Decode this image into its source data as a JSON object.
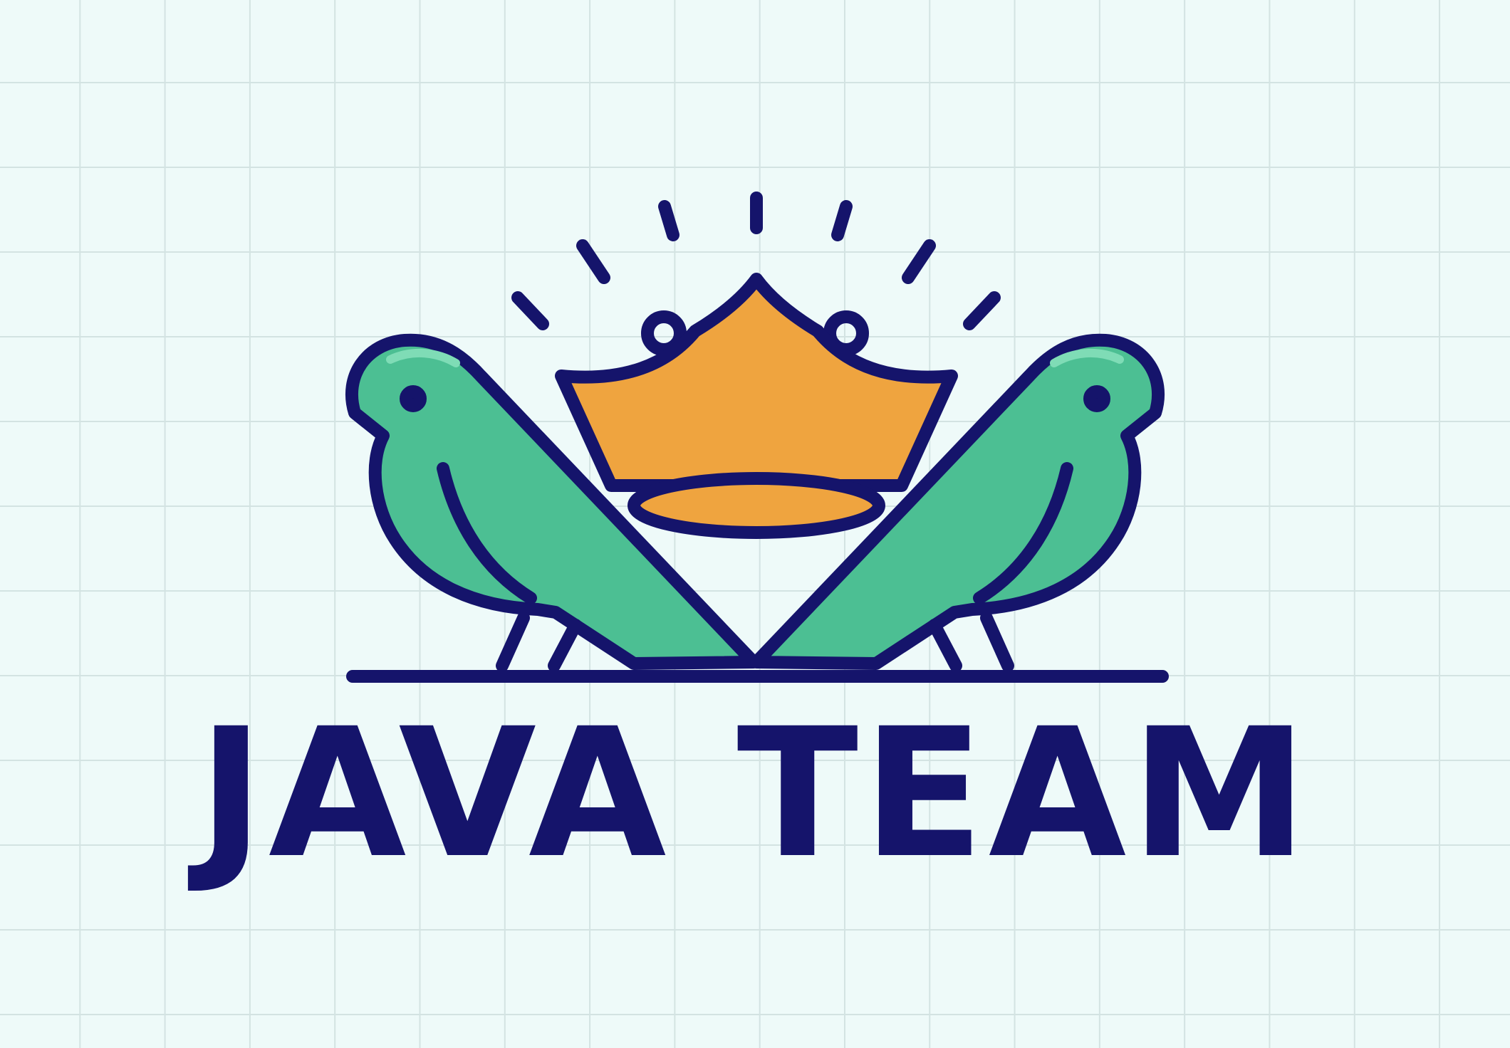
{
  "logo": {
    "wordmark": "JAVA TEAM",
    "emblem": [
      "crown-icon",
      "bird-left-icon",
      "bird-right-icon",
      "perch-line",
      "sparkle-rays"
    ]
  },
  "colors": {
    "background": "#eefaf9",
    "grid": "#d3e3e2",
    "outline": "#15146b",
    "bird": "#4cbf93",
    "bird_highlight": "#7fdcb6",
    "crown": "#efa43f",
    "text": "#15146b"
  }
}
